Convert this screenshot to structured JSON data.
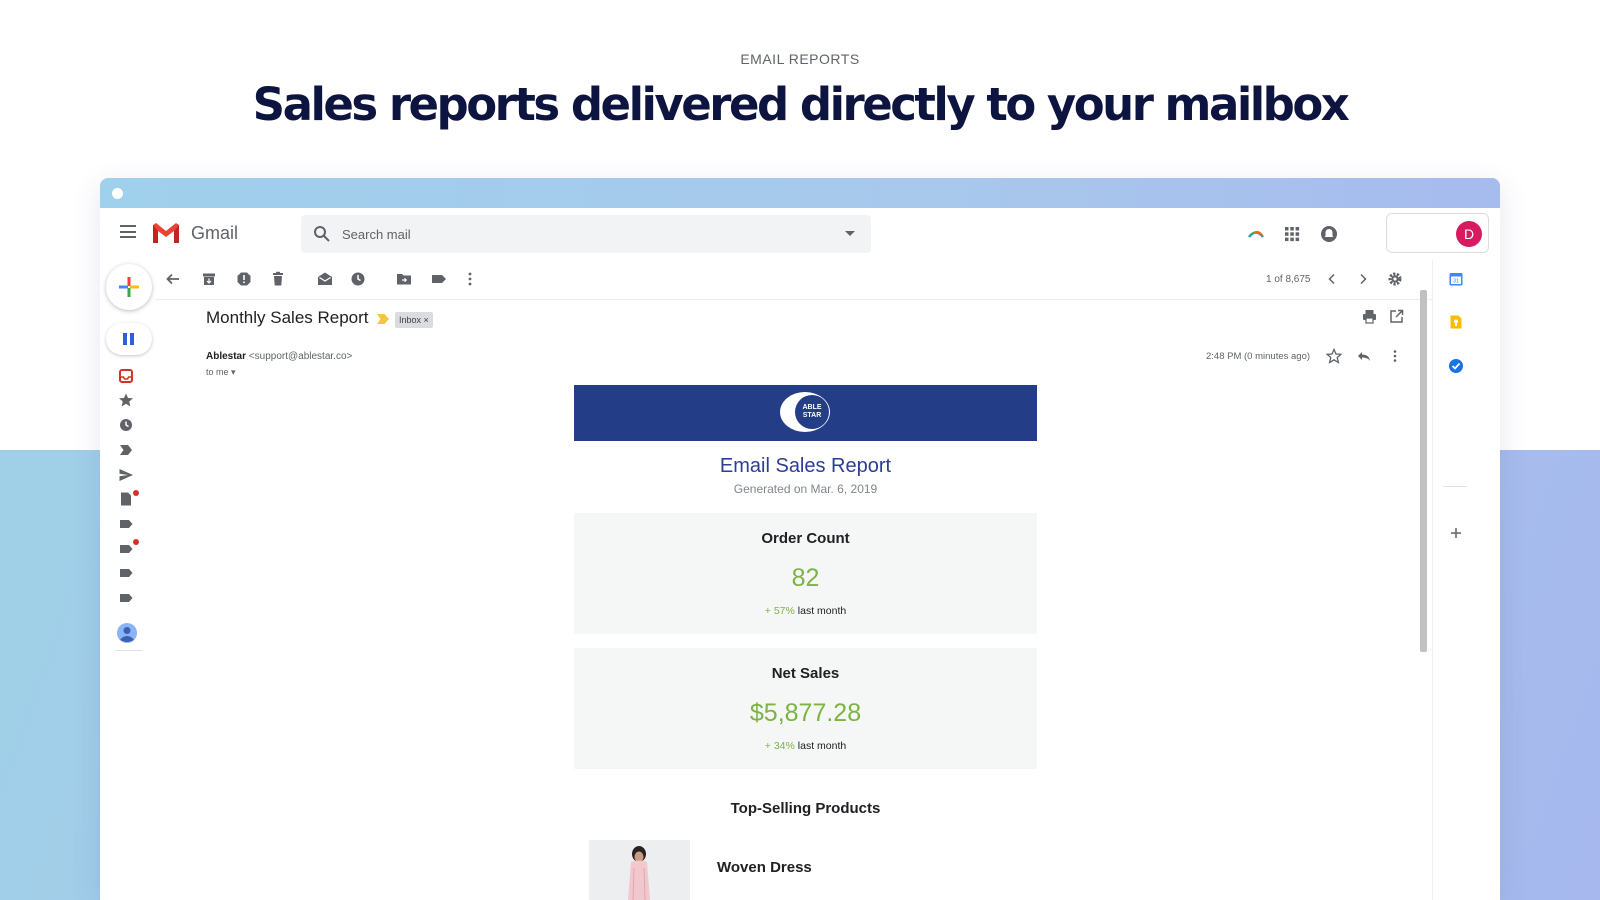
{
  "eyebrow": "EMAIL REPORTS",
  "headline": "Sales reports delivered directly to your mailbox",
  "colors": {
    "headline": "#0d1440",
    "banner": "#233d86",
    "accent_green": "#7cb342",
    "avatar": "#d81b60",
    "gmail_red": "#ea4335"
  },
  "gmail": {
    "app_name": "Gmail",
    "search_placeholder": "Search mail",
    "avatar_letter": "D",
    "pager": "1 of 8,675",
    "icons": {
      "header": [
        "menu-icon",
        "gmail-logo-icon",
        "search-icon",
        "dropdown-caret-icon",
        "addon-icon",
        "apps-grid-icon",
        "notifications-icon"
      ],
      "toolbar": [
        "back-arrow-icon",
        "archive-icon",
        "report-spam-icon",
        "delete-icon",
        "mark-unread-icon",
        "snooze-icon",
        "move-to-icon",
        "label-icon",
        "more-vert-icon",
        "chevron-left-icon",
        "chevron-right-icon",
        "settings-gear-icon"
      ],
      "rail": [
        "compose-plus-icon",
        "pause-icon",
        "inbox-icon",
        "star-icon",
        "clock-icon",
        "important-icon",
        "send-icon",
        "draft-icon",
        "label-icon",
        "contact-avatar-icon"
      ],
      "side_panel": [
        "calendar-icon",
        "keep-icon",
        "tasks-icon",
        "add-icon"
      ]
    }
  },
  "email": {
    "subject": "Monthly Sales Report",
    "label_chip": "Inbox",
    "sender_name": "Ablestar",
    "sender_email": "<support@ablestar.co>",
    "recipient": "to me",
    "timestamp": "2:48 PM (0 minutes ago)",
    "report": {
      "logo_text_line1": "ABLE",
      "logo_text_line2": "STAR",
      "title": "Email Sales Report",
      "generated": "Generated on Mar. 6, 2019",
      "order_count": {
        "label": "Order Count",
        "value": "82",
        "delta_pct": "+ 57%",
        "delta_suffix": " last month"
      },
      "net_sales": {
        "label": "Net Sales",
        "value": "$5,877.28",
        "delta_pct": "+ 34%",
        "delta_suffix": " last month"
      },
      "top_products_title": "Top-Selling Products",
      "products": [
        {
          "name": "Woven Dress"
        }
      ]
    }
  }
}
